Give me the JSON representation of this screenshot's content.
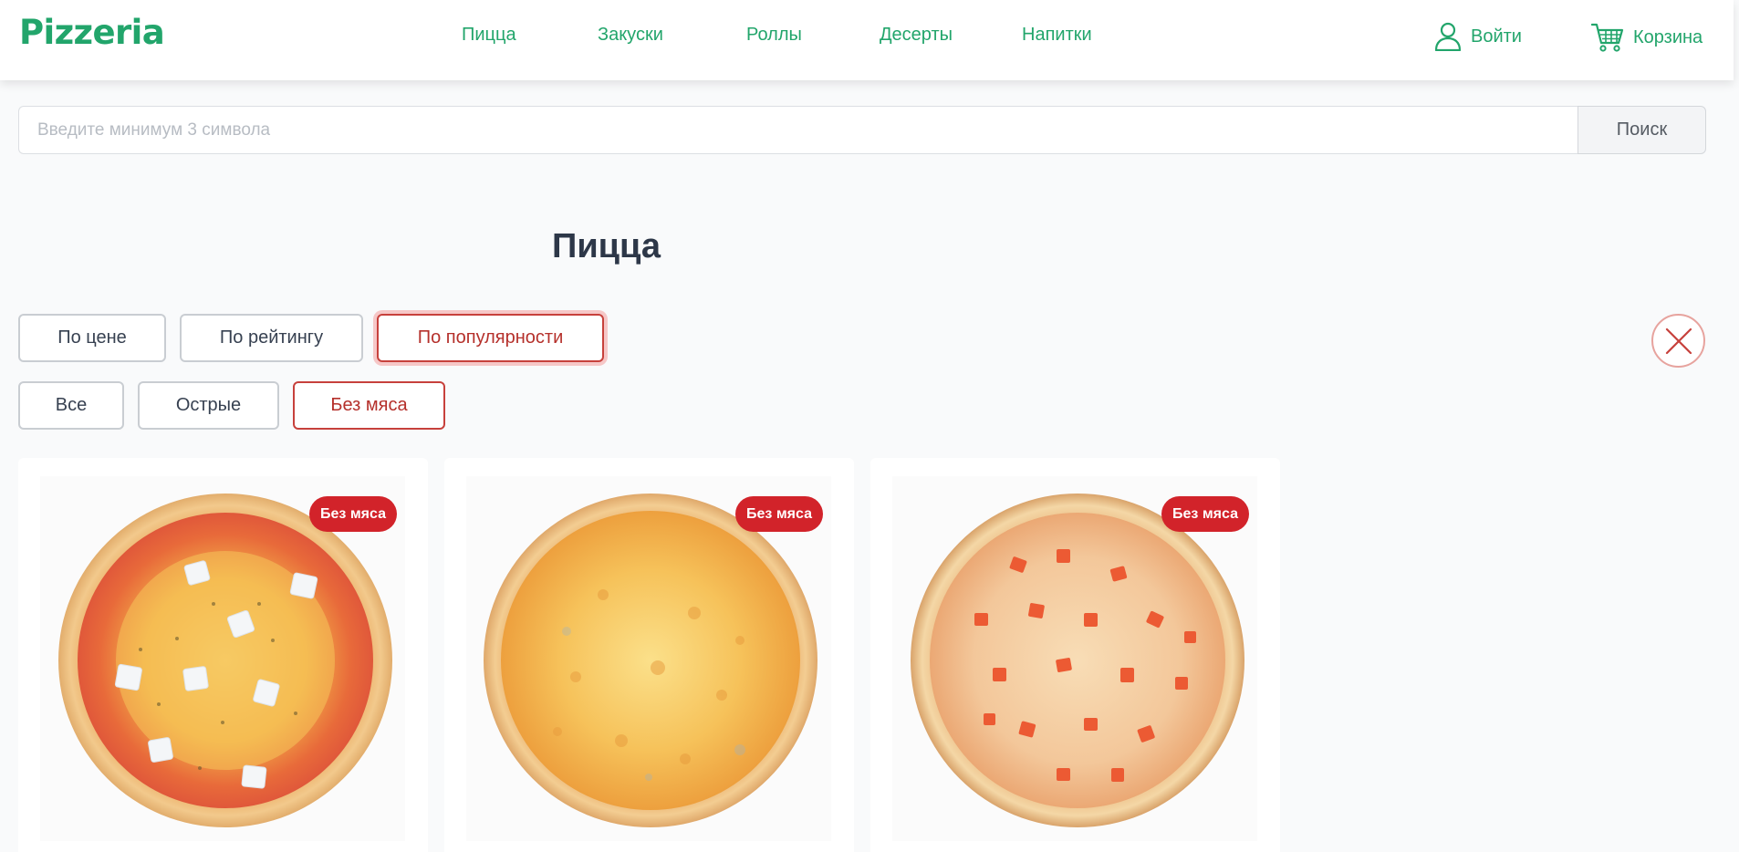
{
  "header": {
    "logo": "Pizzeria",
    "nav": [
      "Пицца",
      "Закуски",
      "Роллы",
      "Десерты",
      "Напитки"
    ],
    "login_label": "Войти",
    "cart_label": "Корзина"
  },
  "search": {
    "placeholder": "Введите минимум 3 символа",
    "value": "",
    "button_label": "Поиск"
  },
  "page_title": "Пицца",
  "sort_options": [
    {
      "label": "По цене",
      "active": false
    },
    {
      "label": "По рейтингу",
      "active": false
    },
    {
      "label": "По популярности",
      "active": true
    }
  ],
  "filter_options": [
    {
      "label": "Все",
      "active": false
    },
    {
      "label": "Острые",
      "active": false
    },
    {
      "label": "Без мяса",
      "active": true
    }
  ],
  "products": [
    {
      "badge": "Без мяса",
      "image": "four-cheese-pizza"
    },
    {
      "badge": "Без мяса",
      "image": "cheese-pizza"
    },
    {
      "badge": "Без мяса",
      "image": "tomato-cheese-pizza"
    }
  ],
  "icons": {
    "login": "user-icon",
    "cart": "cart-icon",
    "close": "close-icon"
  },
  "colors": {
    "brand": "#22a56b",
    "active": "#c7413c",
    "badge": "#d2232a",
    "title": "#2d3748"
  }
}
